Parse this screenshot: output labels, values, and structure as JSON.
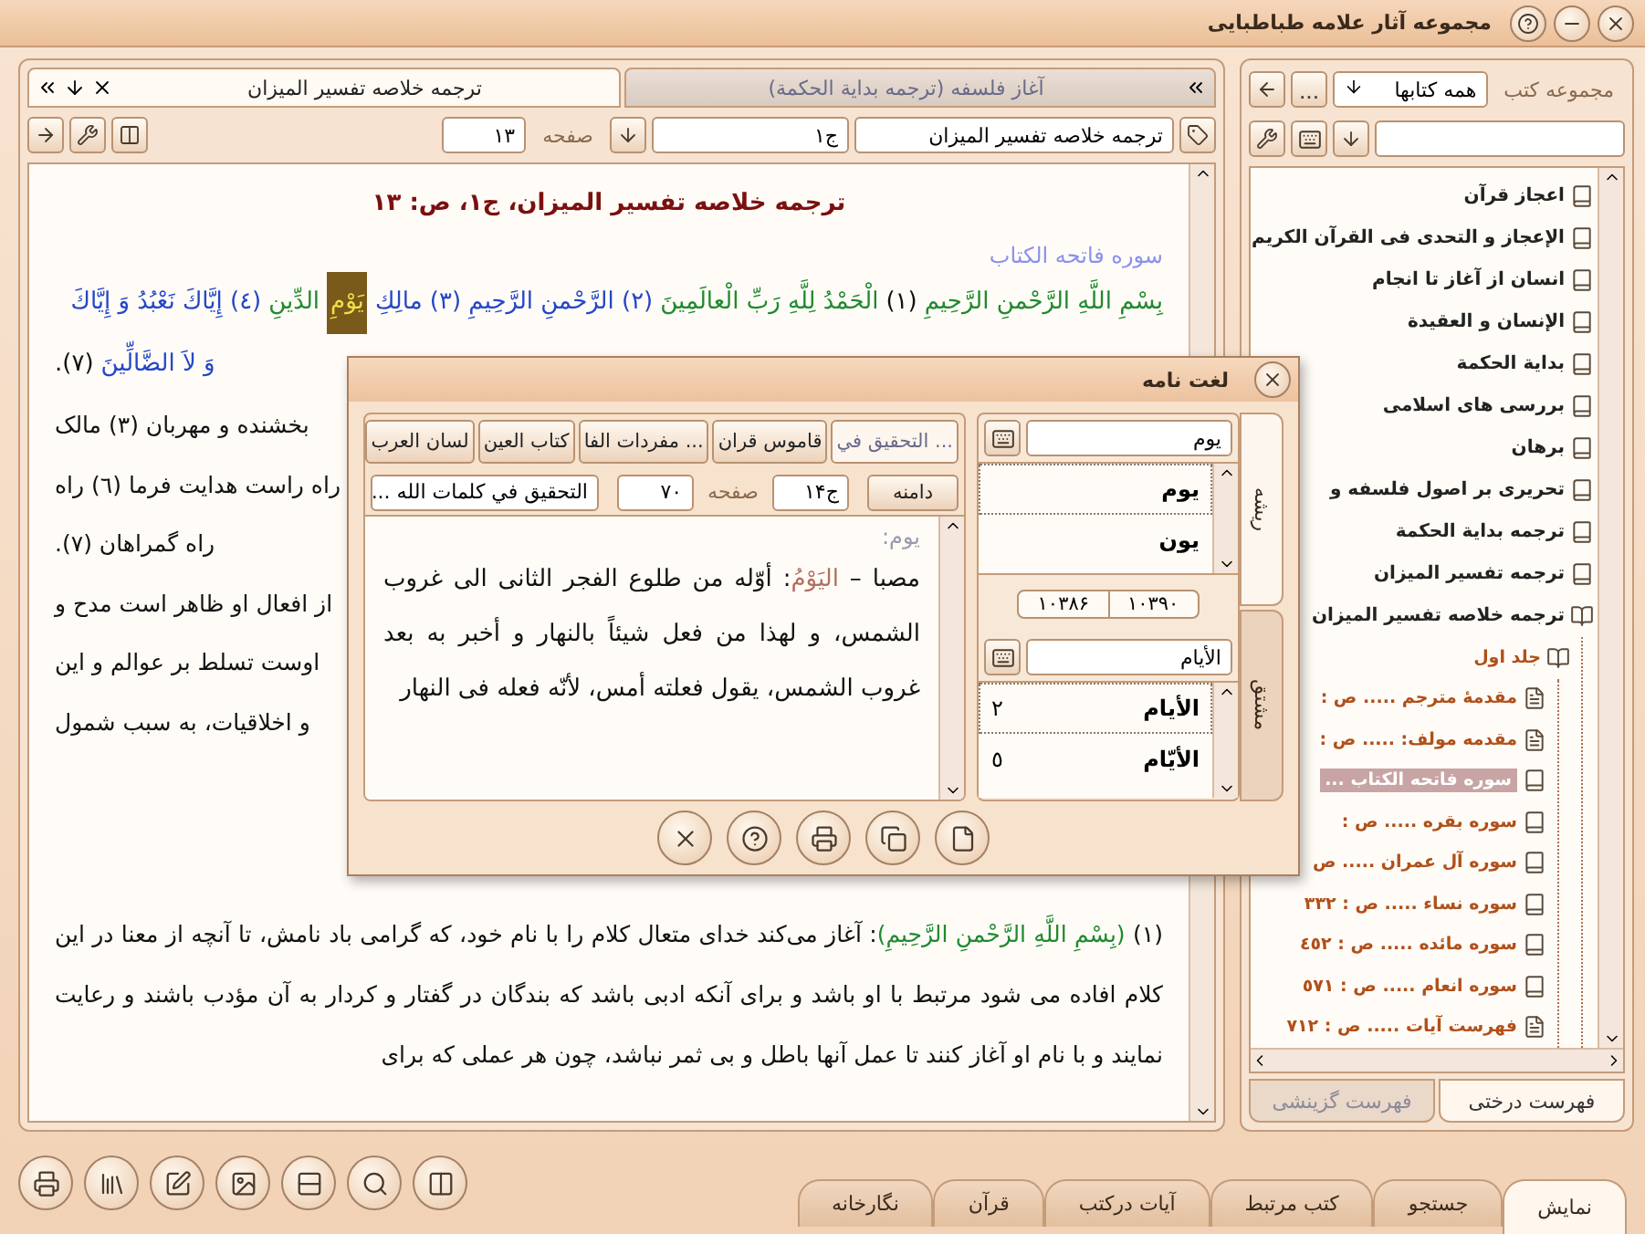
{
  "window": {
    "title": "مجموعه آثار علامه طباطبایی"
  },
  "reader": {
    "tabs": [
      {
        "label": "آغاز فلسفه (ترجمه بداية الحكمة)",
        "selected": false
      },
      {
        "label": "ترجمه خلاصه تفسیر المیزان",
        "selected": true
      }
    ],
    "toolbar": {
      "book": "ترجمه خلاصه تفسیر المیزان",
      "volume": "ج۱",
      "page_label": "صفحه",
      "page": "۱۳"
    },
    "heading": "ترجمه خلاصه تفسیر المیزان، ج۱، ص: ۱۳",
    "sura_title": "سوره فاتحه الکتاب",
    "verse_lines": [
      [
        {
          "kind": "verse",
          "text": "بِسْمِ اللَّهِ الرَّحْمنِ الرَّحِيمِ",
          "color": "#1f8a2e"
        },
        {
          "kind": "verse",
          "text": "(١)",
          "color": "#111111"
        },
        {
          "kind": "verse",
          "text": "الْحَمْدُ لِلَّهِ رَبِّ الْعالَمِينَ",
          "color": "#1f8a2e"
        },
        {
          "kind": "verse",
          "text": "(٢) الرَّحْمنِ الرَّحِيمِ (٣) مالِكِ",
          "color": "#2447c8"
        },
        {
          "kind": "highlight",
          "text": "يَوْمِ",
          "color": "#7a5a1a"
        },
        {
          "kind": "verse",
          "text": "الدِّينِ",
          "color": "#1f8a2e"
        },
        {
          "kind": "verse",
          "text": "(٤) إِيَّاكَ نَعْبُدُ وَ إِيَّاكَ",
          "color": "#2447c8"
        }
      ],
      [
        {
          "kind": "verse",
          "text": "وَ لاَ الضَّالِّينَ",
          "color": "#2447c8"
        },
        {
          "kind": "verse",
          "text": "(٧).",
          "color": "#111111"
        }
      ]
    ],
    "translation_lines": [
      "بخشنده و مهربان (٣) مالک",
      "راه راست هدایت فرما (٦) راه",
      "راه گمراهان (٧).",
      "از افعال او ظاهر است مدح و",
      "اوست تسلط بر عوالم و این",
      "و اخلاقیات، به سبب شمول"
    ],
    "commentary": {
      "number": "(١)",
      "quote": "(بِسْمِ اللَّهِ الرَّحْمنِ الرَّحِيمِ)",
      "text": ": آغاز می‌کند خدای متعال کلام را با نام خود، که گرامی باد نامش، تا آنچه از معنا در این کلام افاده می شود مرتبط با او باشد و برای آنکه ادبی باشد که بندگان در گفتار و کردار به آن مؤدب باشند و رعایت نمایند و با نام او آغاز کنند تا عمل آنها باطل و بی ثمر نباشد، چون هر عملی که برای"
    }
  },
  "library": {
    "label": "مجموعه کتب",
    "filter": "همه کتابها",
    "more": "...",
    "tree": [
      {
        "kind": "book",
        "label": "اعجاز قرآن",
        "selected": false
      },
      {
        "kind": "book",
        "label": "الإعجاز و التحدى فى القرآن الكريم",
        "selected": false
      },
      {
        "kind": "book",
        "label": "انسان از آغاز تا انجام",
        "selected": false
      },
      {
        "kind": "book",
        "label": "الإنسان و العقيدة",
        "selected": false
      },
      {
        "kind": "book",
        "label": "بداية الحكمة",
        "selected": false
      },
      {
        "kind": "book",
        "label": "بررسی های اسلامی",
        "selected": false
      },
      {
        "kind": "book",
        "label": "برهان",
        "selected": false
      },
      {
        "kind": "book",
        "label": "تحریری بر اصول فلسفه و",
        "selected": false
      },
      {
        "kind": "book",
        "label": "ترجمه بداية الحكمة",
        "selected": false
      },
      {
        "kind": "book",
        "label": "ترجمه تفسیر المیزان",
        "selected": false
      },
      {
        "kind": "open-book",
        "label": "ترجمه خلاصه تفسیر المیزان",
        "selected": false,
        "children": [
          {
            "kind": "open-book",
            "label": "جلد اول",
            "selected": false,
            "children": [
              {
                "kind": "page",
                "label": "مقدمهٔ مترجم ..... ص :",
                "selected": false
              },
              {
                "kind": "page",
                "label": "مقدمه مولف: ..... ص :",
                "selected": false
              },
              {
                "kind": "book",
                "label": "سوره فاتحه الکتاب ...",
                "selected": true
              },
              {
                "kind": "book",
                "label": "سوره بقره ..... ص :",
                "selected": false
              },
              {
                "kind": "book",
                "label": "سوره آل عمران ..... ص",
                "selected": false
              },
              {
                "kind": "book",
                "label": "سوره نساء ..... ص : ٣٣٢",
                "selected": false
              },
              {
                "kind": "book",
                "label": "سوره مائده ..... ص : ٤٥٢",
                "selected": false
              },
              {
                "kind": "book",
                "label": "سوره انعام ..... ص : ٥٧١",
                "selected": false
              },
              {
                "kind": "page",
                "label": "فهرست آیات ..... ص : ٧١٢",
                "selected": false
              }
            ]
          }
        ]
      }
    ],
    "tabs": [
      {
        "label": "فهرست درختی",
        "selected": true
      },
      {
        "label": "فهرست گزینشی",
        "selected": false
      }
    ]
  },
  "bottom_tabs": [
    {
      "label": "نمایش",
      "selected": true
    },
    {
      "label": "جستجو",
      "selected": false
    },
    {
      "label": "کتب مرتبط",
      "selected": false
    },
    {
      "label": "آیات درکتب",
      "selected": false
    },
    {
      "label": "قرآن",
      "selected": false
    },
    {
      "label": "نگارخانه",
      "selected": false
    }
  ],
  "dictionary": {
    "title": "لغت نامه",
    "side_tabs": [
      {
        "label": "ریشه",
        "selected": true
      },
      {
        "label": "مشتق",
        "selected": false
      }
    ],
    "root_search": "یوم",
    "roots": [
      {
        "label": "یوم",
        "selected": true
      },
      {
        "label": "یون",
        "selected": false
      }
    ],
    "range": {
      "from": "١٠٣٩٠",
      "to": "١٠٣٨۶"
    },
    "derived_search": "الأيام",
    "derived": [
      {
        "label": "الأيام",
        "count": "٢",
        "selected": true
      },
      {
        "label": "الأيّام",
        "count": "٥",
        "selected": false
      }
    ],
    "source_tabs": [
      {
        "label": "التحقيق في ...",
        "selected": true
      },
      {
        "label": "قاموس قران",
        "selected": false
      },
      {
        "label": "مفردات الفا ...",
        "selected": false
      },
      {
        "label": "كتاب العين",
        "selected": false
      },
      {
        "label": "لسان العرب",
        "selected": false
      }
    ],
    "scope_button": "دامنه",
    "volume": "ج١۴",
    "page_label": "صفحه",
    "page": "٧٠",
    "source": "التحقيق في كلمات الله ...",
    "entry_word": "یوم:",
    "entry_prefix": "مصبا –",
    "entry_head": "اليَوْمُ",
    "entry_text": ": أوّله من طلوع الفجر الثانى الى غروب الشمس، و لهذا من فعل شيئاً بالنهار و أخبر به بعد غروب الشمس، يقول فعلته أمس، لأنّه فعله فى النهار"
  }
}
